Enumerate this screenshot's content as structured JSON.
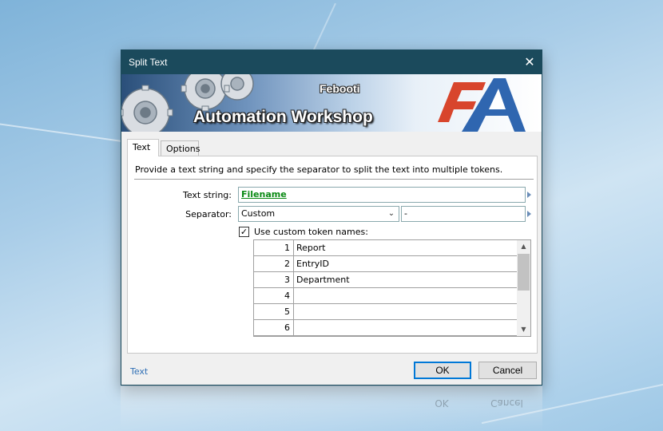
{
  "window": {
    "title": "Split Text",
    "close_glyph": "✕"
  },
  "banner": {
    "brand_small": "Febooti",
    "brand_large": "Automation Workshop"
  },
  "tabs": [
    {
      "label": "Text",
      "active": true
    },
    {
      "label": "Options",
      "active": false
    }
  ],
  "panel": {
    "description": "Provide a text string and specify the separator to split the text into multiple tokens.",
    "text_string": {
      "label": "Text string:",
      "value": "Filename"
    },
    "separator": {
      "label": "Separator:",
      "value": "Custom",
      "custom_value": "-"
    },
    "use_custom_names": {
      "label": "Use custom token names:",
      "checked": true,
      "check_glyph": "✓"
    },
    "tokens": [
      {
        "num": "1",
        "name": "Report"
      },
      {
        "num": "2",
        "name": "EntryID"
      },
      {
        "num": "3",
        "name": "Department"
      },
      {
        "num": "4",
        "name": ""
      },
      {
        "num": "5",
        "name": ""
      },
      {
        "num": "6",
        "name": ""
      }
    ]
  },
  "footer": {
    "link": "Text",
    "ok_label": "OK",
    "cancel_label": "Cancel"
  },
  "colors": {
    "titlebar": "#1b4a5c",
    "link_green": "#0a8a14",
    "accent_blue": "#0078d7"
  }
}
